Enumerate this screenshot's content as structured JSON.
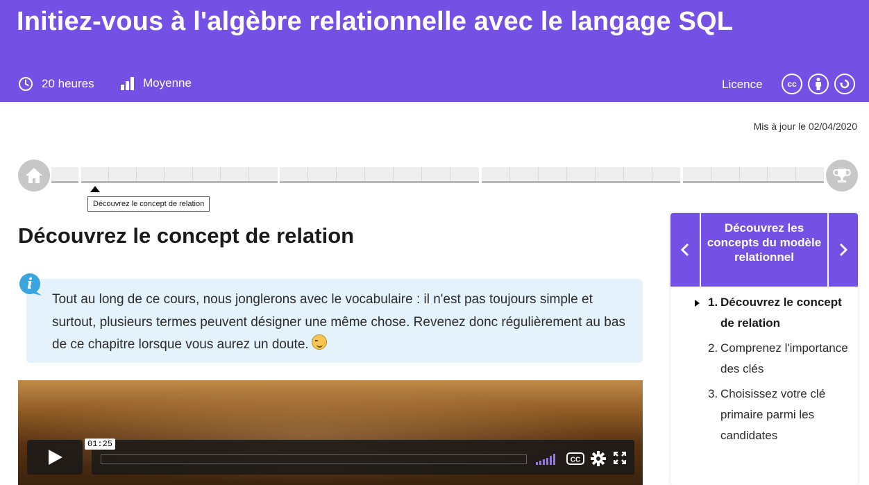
{
  "header": {
    "title": "Initiez-vous à l'algèbre relationnelle avec le langage SQL",
    "duration": "20 heures",
    "level": "Moyenne",
    "license_label": "Licence",
    "license_icons": [
      "cc-icon",
      "attribution-icon",
      "share-alike-icon"
    ],
    "cc_text": "cc"
  },
  "updated": "Mis à jour le 02/04/2020",
  "progress": {
    "tooltip": "Découvrez le concept de relation",
    "current_segment_part": 1,
    "current_segment_index": 0
  },
  "chapter": {
    "title": "Découvrez le concept de relation",
    "info_text": "Tout au long de ce cours, nous jonglerons avec le vocabulaire : il n'est pas toujours simple et surtout, plusieurs termes peuvent désigner une même chose. Revenez donc régulièrement au bas de ce chapitre lorsque vous aurez un doute."
  },
  "video": {
    "time": "01:25",
    "cc_label": "CC"
  },
  "sidebar": {
    "part_title": "Découvrez les concepts du modèle relationnel",
    "items": [
      {
        "num": "1.",
        "label": "Découvrez le concept de relation",
        "active": true
      },
      {
        "num": "2.",
        "label": "Comprenez l'importance des clés",
        "active": false
      },
      {
        "num": "3.",
        "label": "Choisissez votre clé primaire parmi les candidates",
        "active": false
      }
    ]
  },
  "colors": {
    "brand": "#7451e4",
    "info_bg": "#e4f2fb",
    "progress_idle": "#c7c7c7"
  }
}
